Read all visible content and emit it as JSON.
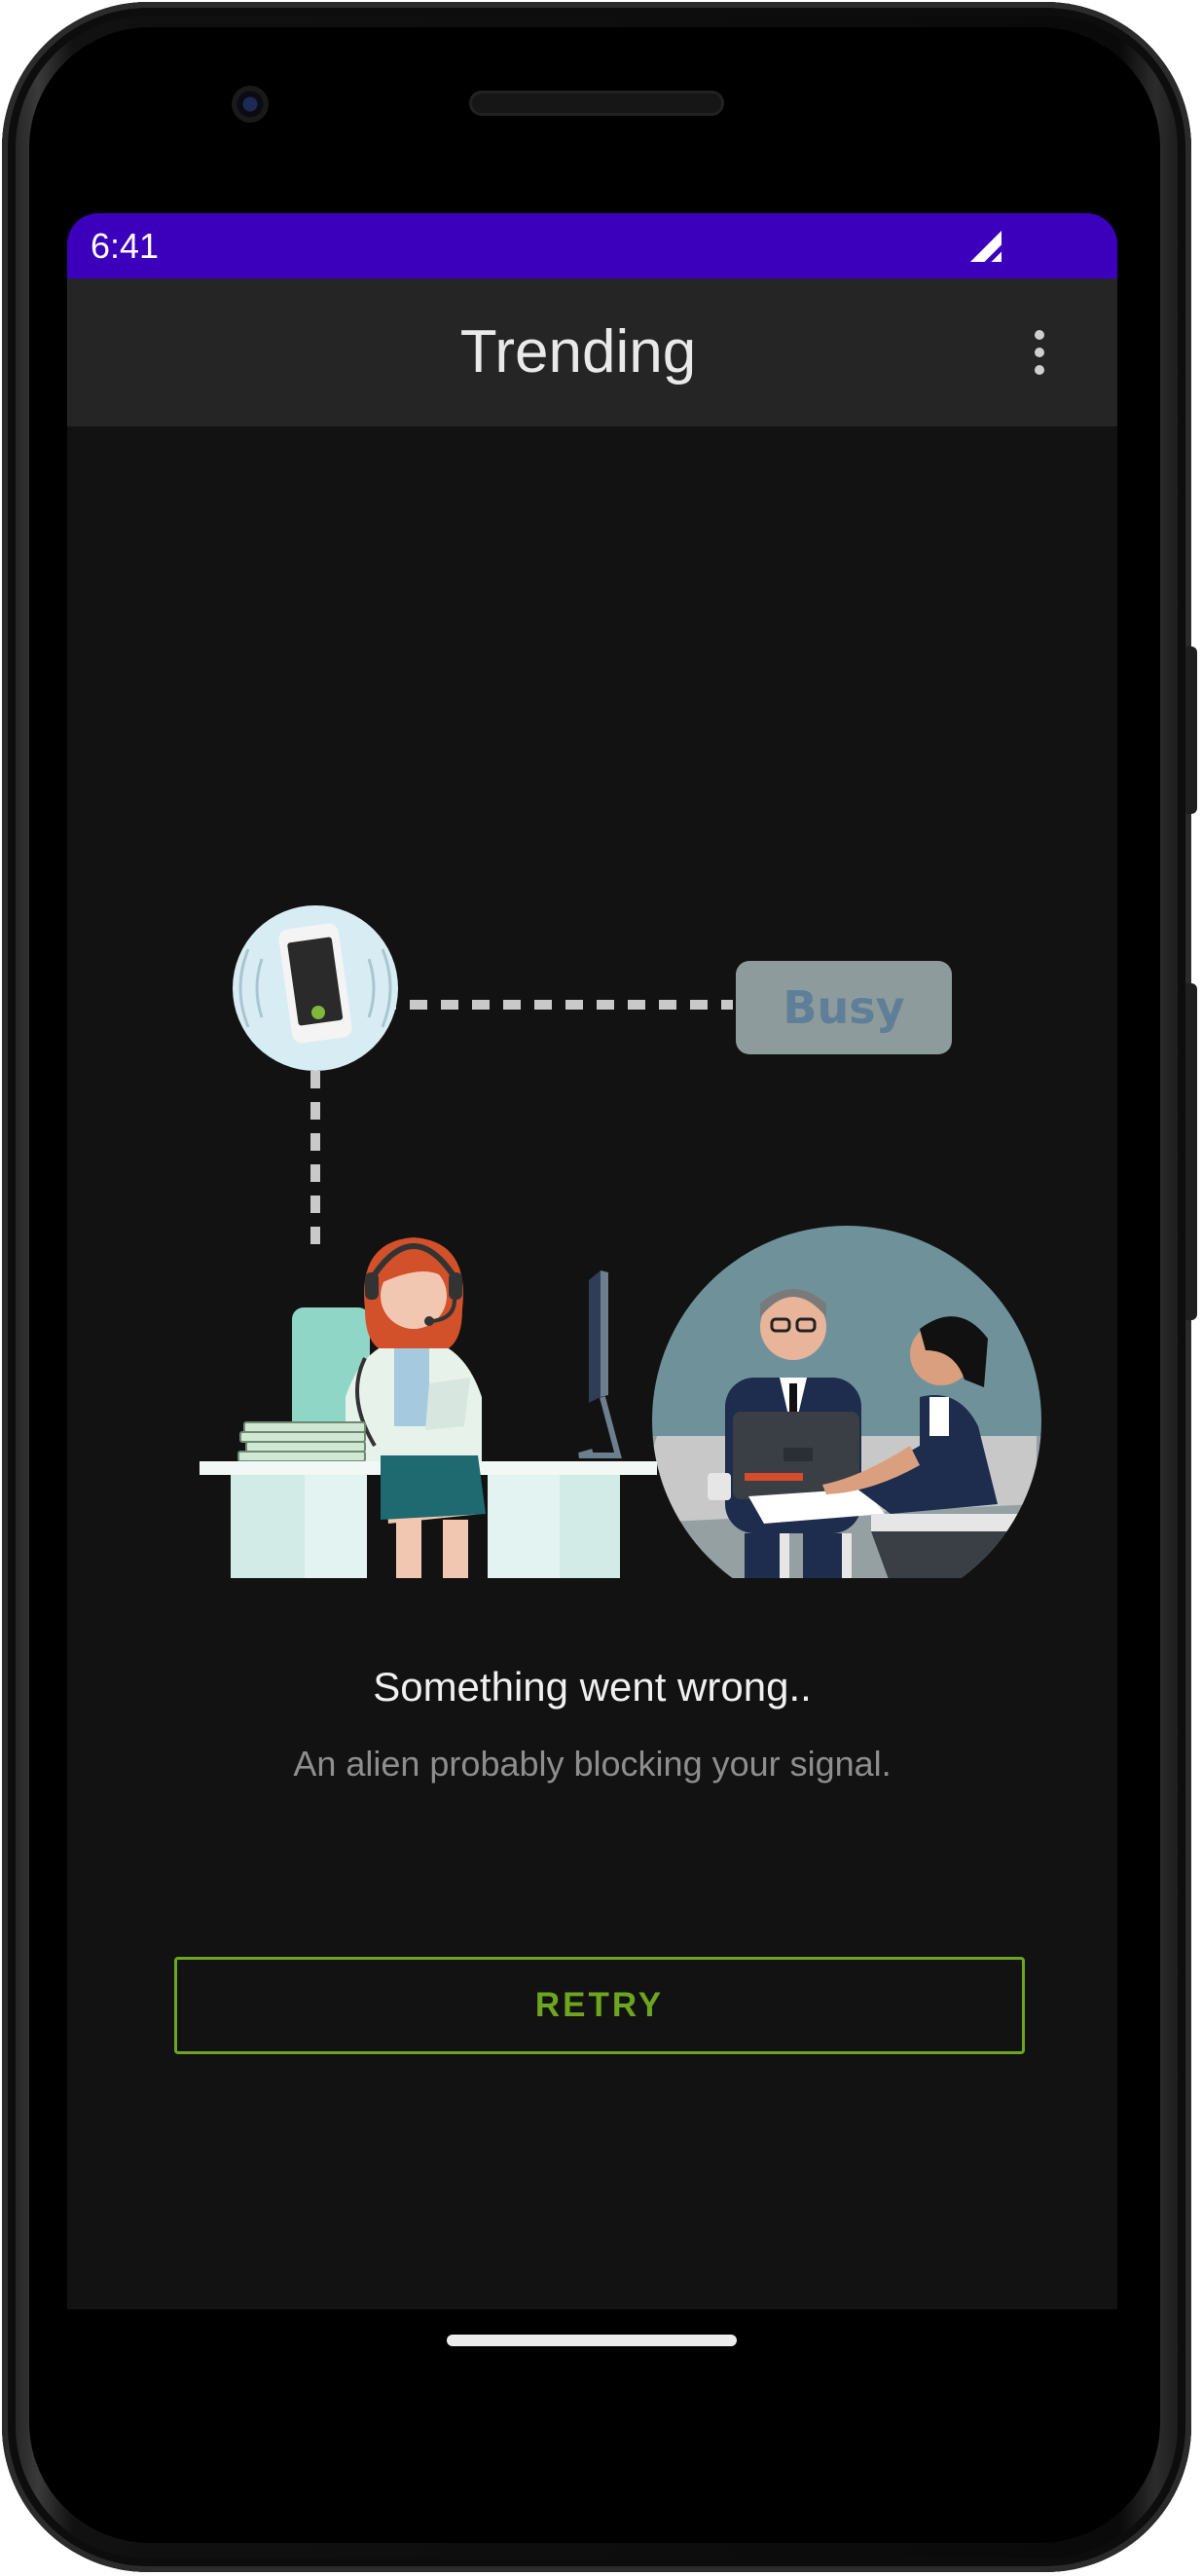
{
  "status_bar": {
    "time": "6:41",
    "icons": [
      "signal-icon"
    ]
  },
  "app_bar": {
    "title": "Trending",
    "menu_icon": "overflow-menu-icon"
  },
  "illustration": {
    "badge_label": "Busy",
    "icons": [
      "phone-call-icon",
      "receptionist-illustration",
      "meeting-illustration"
    ]
  },
  "error": {
    "title": "Something went wrong..",
    "subtitle": "An alien probably blocking your signal."
  },
  "retry_button": {
    "label": "RETRY"
  },
  "colors": {
    "status_bar": "#3c00bc",
    "app_bar": "#252525",
    "background": "#121212",
    "accent": "#6ea51e"
  }
}
